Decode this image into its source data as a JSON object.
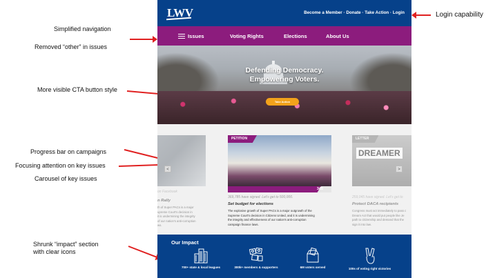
{
  "annotations": {
    "login": "Login capability",
    "nav": "Simplified navigation",
    "removed": "Removed “other” in issues",
    "cta": "More visible CTA button style",
    "progress": "Progress bar on campaigns",
    "focus": "Focusing attention on key issues",
    "carousel": "Carousel of key issues",
    "impact_line1": "Shrunk “impact” section",
    "impact_line2": "with clear icons"
  },
  "header": {
    "logo": "LWV",
    "links": "Become a Member · Donate · Take Action · Login"
  },
  "nav": {
    "items": [
      "Issues",
      "Voting Rights",
      "Elections",
      "About Us"
    ]
  },
  "hero": {
    "line1": "Defending Democracy.",
    "line2": "Empowering Voters.",
    "cta": "Take Action"
  },
  "campaigns": {
    "left": {
      "sub": "on Facebook",
      "title": "n Rally",
      "desc": "th of Super PACs is a major\nupreme Court's decision in\nit is undermining the integrity\nof our nation's anti-corruption\nws."
    },
    "center": {
      "tag": "PETITION",
      "progress_value": 0.9,
      "progress_label": "345",
      "signed": "369,785 have signed. Let's get to 500,000.",
      "title": "Set budget for elections",
      "desc": "The explosive growth of Super PACs is a major outgrowth of the\nSupreme Court's decision in Citizens United, and it is undermining\nthe integrity and effectiveness of our nation's anti-corruption\ncampaign finance laws."
    },
    "right": {
      "tag": "LETTER",
      "photo_text": "DREAMER",
      "signed": "259,045 have signed. Let's get to",
      "title": "Protect DACA recipients",
      "desc": "Congress must act immediately to pass c\nDream Act that would put people like Je\npath to citizenship and demand that the\nsign it into law."
    },
    "prev": "<",
    "next": ">"
  },
  "impact": {
    "title": "Our Impact",
    "stats": [
      {
        "label": "700+ state & local leagues",
        "icon": "buildings-icon"
      },
      {
        "label": "300k+ members & supporters",
        "icon": "people-icon"
      },
      {
        "label": "6M voters served",
        "icon": "ballot-box-icon"
      },
      {
        "label": "100s of voting right victories",
        "icon": "victory-hand-icon"
      }
    ]
  },
  "colors": {
    "blue": "#06418a",
    "purple": "#8c1c7d",
    "orange": "#f2a21b",
    "arrow": "#e02020"
  }
}
